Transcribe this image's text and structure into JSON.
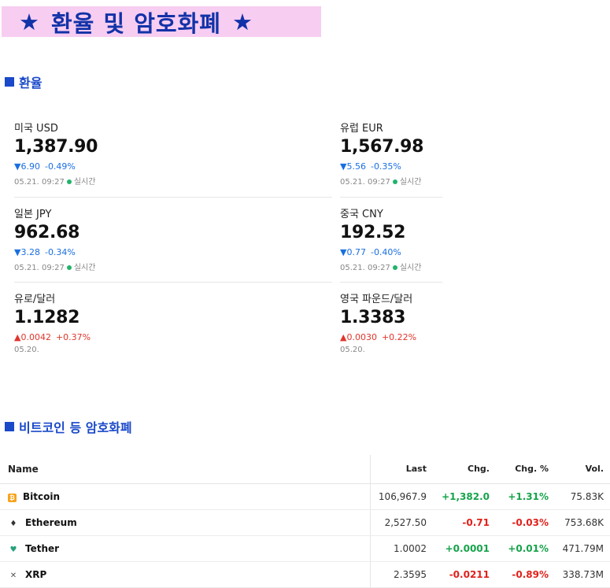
{
  "banner": {
    "star_left": "★",
    "title": "환율 및 암호화폐",
    "star_right": "★"
  },
  "sections": {
    "fx_title": "환율",
    "crypto_title": "비트코인 등 암호화폐"
  },
  "fx": [
    {
      "name": "미국 USD",
      "value": "1,387.90",
      "direction": "down",
      "arrow": "▼",
      "change": "6.90",
      "pct": "-0.49%",
      "time": "05.21. 09:27",
      "live": "실시간"
    },
    {
      "name": "유럽 EUR",
      "value": "1,567.98",
      "direction": "down",
      "arrow": "▼",
      "change": "5.56",
      "pct": "-0.35%",
      "time": "05.21. 09:27",
      "live": "실시간"
    },
    {
      "name": "일본 JPY",
      "value": "962.68",
      "direction": "down",
      "arrow": "▼",
      "change": "3.28",
      "pct": "-0.34%",
      "time": "05.21. 09:27",
      "live": "실시간"
    },
    {
      "name": "중국 CNY",
      "value": "192.52",
      "direction": "down",
      "arrow": "▼",
      "change": "0.77",
      "pct": "-0.40%",
      "time": "05.21. 09:27",
      "live": "실시간"
    },
    {
      "name": "유로/달러",
      "value": "1.1282",
      "direction": "up",
      "arrow": "▲",
      "change": "0.0042",
      "pct": "+0.37%",
      "time": "05.20.",
      "live": ""
    },
    {
      "name": "영국 파운드/달러",
      "value": "1.3383",
      "direction": "up",
      "arrow": "▲",
      "change": "0.0030",
      "pct": "+0.22%",
      "time": "05.20.",
      "live": ""
    }
  ],
  "crypto": {
    "headers": {
      "name": "Name",
      "last": "Last",
      "chg": "Chg.",
      "chg_pct": "Chg. %",
      "vol": "Vol."
    },
    "rows": [
      {
        "icon": "bitcoin-icon",
        "glyph": "₿",
        "name": "Bitcoin",
        "last": "106,967.9",
        "chg": "+1,382.0",
        "chg_pct": "+1.31%",
        "vol": "75.83K",
        "dir": "pos"
      },
      {
        "icon": "ethereum-icon",
        "glyph": "♦",
        "name": "Ethereum",
        "last": "2,527.50",
        "chg": "-0.71",
        "chg_pct": "-0.03%",
        "vol": "753.68K",
        "dir": "neg"
      },
      {
        "icon": "tether-icon",
        "glyph": "♥",
        "name": "Tether",
        "last": "1.0002",
        "chg": "+0.0001",
        "chg_pct": "+0.01%",
        "vol": "471.79M",
        "dir": "pos"
      },
      {
        "icon": "xrp-icon",
        "glyph": "✕",
        "name": "XRP",
        "last": "2.3595",
        "chg": "-0.0211",
        "chg_pct": "-0.89%",
        "vol": "338.73M",
        "dir": "neg"
      }
    ]
  },
  "colors": {
    "banner_bg": "#f7cdf1",
    "accent": "#1a49c9",
    "down": "#1a6fe0",
    "up": "#e0352b",
    "pos": "#16a34a",
    "neg": "#e0211b",
    "live_dot": "#21b36b"
  }
}
